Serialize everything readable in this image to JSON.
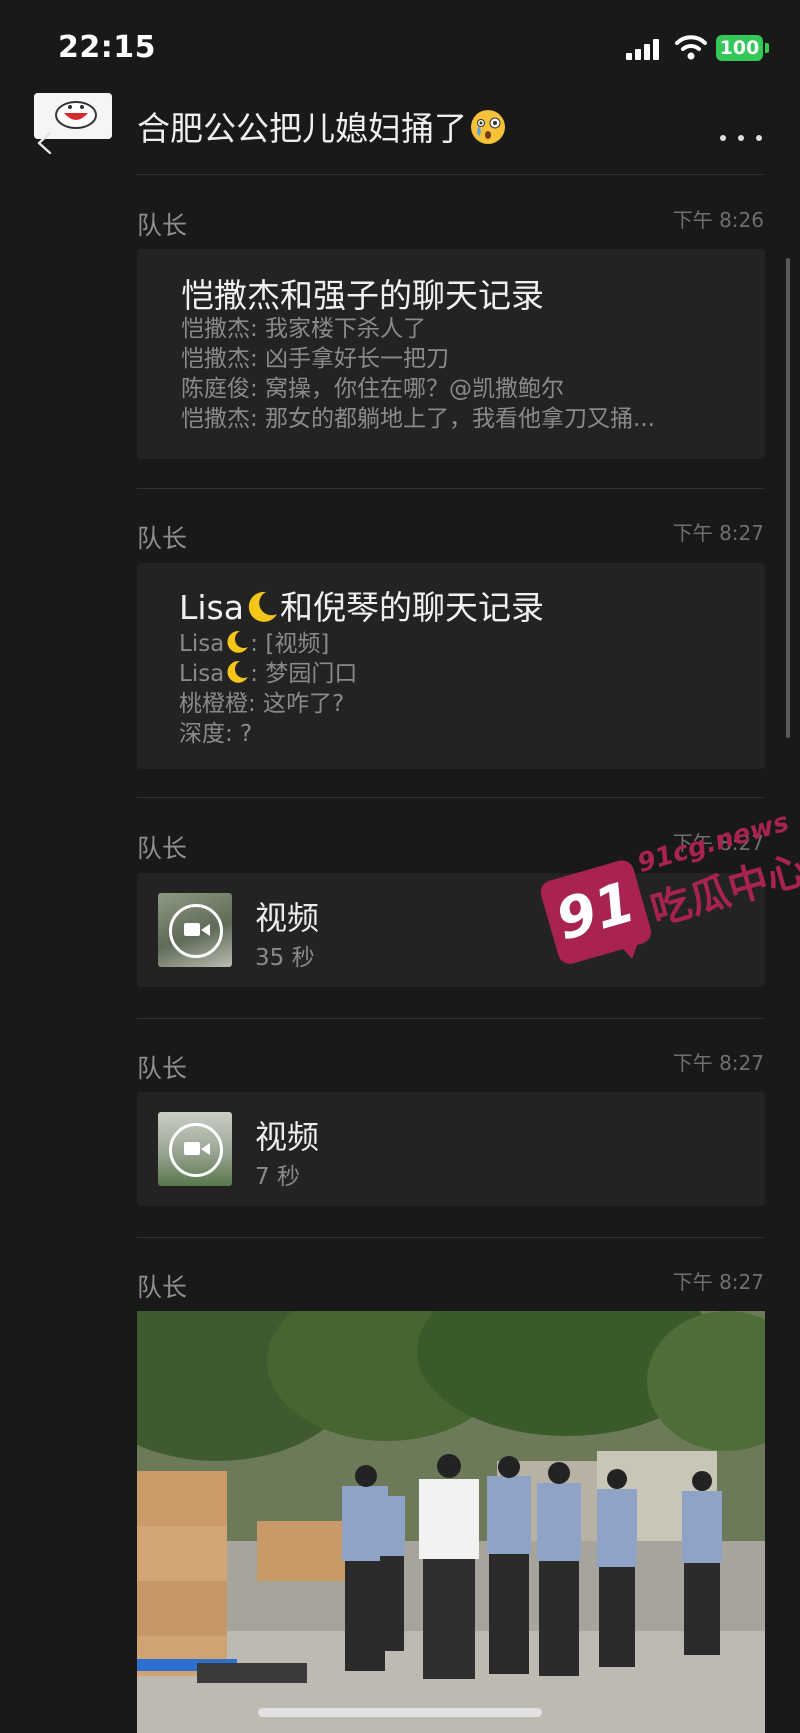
{
  "status_bar": {
    "time": "22:15",
    "battery": "100"
  },
  "header": {
    "title": "合肥公公把儿媳妇捅了"
  },
  "messages": [
    {
      "sender": "队长",
      "time": "下午 8:26",
      "record_title": "恺撒杰和强子的聊天记录",
      "lines": [
        "恺撒杰: 我家楼下杀人了",
        "恺撒杰: 凶手拿好长一把刀",
        "陈庭俊: 窝操，你住在哪？@凯撒鲍尔",
        "恺撒杰: 那女的都躺地上了，我看他拿刀又捅..."
      ]
    },
    {
      "sender": "队长",
      "time": "下午 8:27",
      "record_title_pre": "Lisa",
      "record_title_post": "和倪琴的聊天记录",
      "lines": [
        {
          "name": "Lisa",
          "text": ": [视频]"
        },
        {
          "name": "Lisa",
          "text": ": 梦园门口"
        },
        {
          "name": "",
          "text": "桃橙橙: 这咋了?"
        },
        {
          "name": "",
          "text": "深度: ?"
        }
      ]
    },
    {
      "sender": "队长",
      "time": "下午 8:27",
      "label": "视频",
      "duration": "35 秒"
    },
    {
      "sender": "队长",
      "time": "下午 8:27",
      "label": "视频",
      "duration": "7 秒"
    },
    {
      "sender": "队长",
      "time": "下午 8:27"
    }
  ],
  "watermark": {
    "badge": "91",
    "site": "91cg.news",
    "name": "吃瓜中心"
  },
  "colors": {
    "background": "#191919",
    "card": "#232323",
    "battery": "#34c759",
    "watermark": "#a8234f"
  }
}
